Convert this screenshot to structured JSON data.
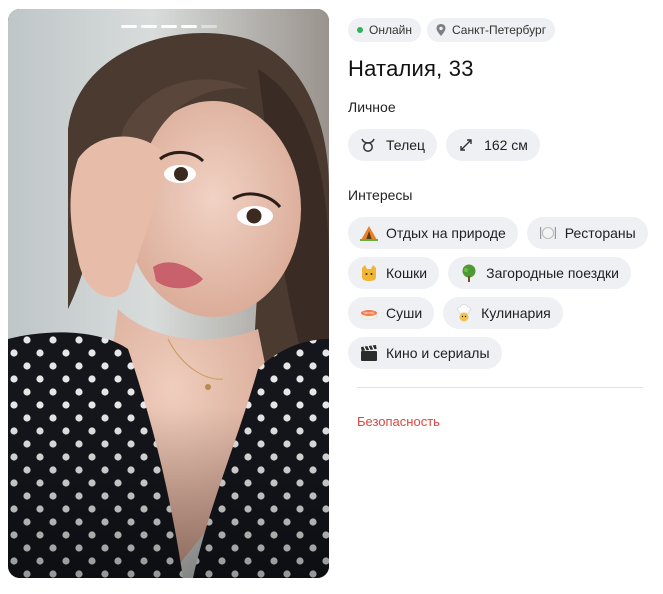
{
  "photo": {
    "pages_total": 5,
    "page_active": 1
  },
  "status": {
    "online_label": "Онлайн",
    "city": "Санкт-Петербург"
  },
  "profile": {
    "name_age": "Наталия, 33"
  },
  "personal": {
    "title": "Личное",
    "items": [
      {
        "icon": "taurus-icon",
        "label": "Телец"
      },
      {
        "icon": "height-icon",
        "label": "162 см"
      }
    ]
  },
  "interests": {
    "title": "Интересы",
    "items": [
      {
        "icon": "camping-icon",
        "label": "Отдых на природе"
      },
      {
        "icon": "cutlery-icon",
        "label": "Рестораны"
      },
      {
        "icon": "cat-icon",
        "label": "Кошки"
      },
      {
        "icon": "tree-icon",
        "label": "Загородные поездки"
      },
      {
        "icon": "sushi-icon",
        "label": "Суши"
      },
      {
        "icon": "chef-icon",
        "label": "Кулинария"
      },
      {
        "icon": "clapper-icon",
        "label": "Кино и сериалы"
      }
    ]
  },
  "footer": {
    "safety_link": "Безопасность"
  },
  "colors": {
    "chip_bg": "#eef0f3",
    "online": "#2fb45a",
    "safety": "#e0453d"
  }
}
